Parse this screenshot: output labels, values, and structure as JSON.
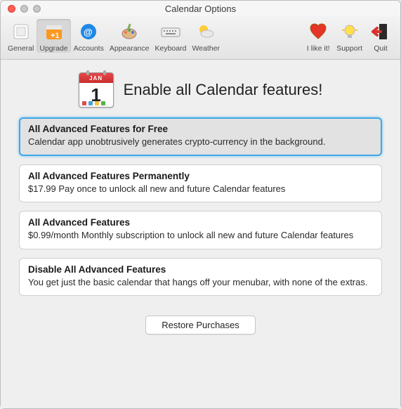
{
  "window": {
    "title": "Calendar Options"
  },
  "toolbar": {
    "items": [
      {
        "label": "General"
      },
      {
        "label": "Upgrade"
      },
      {
        "label": "Accounts"
      },
      {
        "label": "Appearance"
      },
      {
        "label": "Keyboard"
      },
      {
        "label": "Weather"
      }
    ],
    "right_items": [
      {
        "label": "I like it!"
      },
      {
        "label": "Support"
      },
      {
        "label": "Quit"
      }
    ],
    "selected": "Upgrade"
  },
  "hero": {
    "month_abbr": "JAN",
    "day_number": "1",
    "title": "Enable all Calendar features!"
  },
  "options": [
    {
      "title": "All Advanced Features for Free",
      "desc": "Calendar app unobtrusively generates crypto-currency in the background.",
      "selected": true
    },
    {
      "title": "All Advanced Features Permanently",
      "desc": "$17.99 Pay once to unlock all new and future Calendar features",
      "selected": false
    },
    {
      "title": "All Advanced Features",
      "desc": "$0.99/month Monthly subscription to unlock all new and future Calendar features",
      "selected": false
    },
    {
      "title": "Disable All Advanced Features",
      "desc": "You get just the basic calendar that hangs off your menubar, with none of the extras.",
      "selected": false
    }
  ],
  "footer": {
    "restore_label": "Restore Purchases"
  }
}
